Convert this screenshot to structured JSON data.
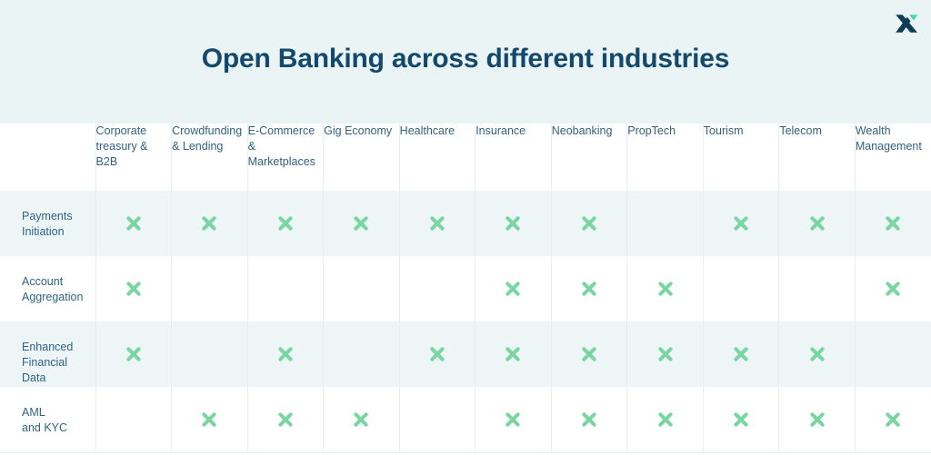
{
  "banner": {
    "title": "Open Banking across different industries",
    "logo_name": "x-logo",
    "background_color": "#eaf4f4",
    "title_color": "#13496b"
  },
  "table": {
    "corner_label": "",
    "columns": [
      "Corporate treasury & B2B",
      "Crowdfunding & Lending",
      "E-Commerce & Marketplaces",
      "Gig Economy",
      "Healthcare",
      "Insurance",
      "Neobanking",
      "PropTech",
      "Tourism",
      "Telecom",
      "Wealth Management"
    ],
    "rows": [
      {
        "label": "Payments\nInitiation",
        "marks": [
          true,
          true,
          true,
          true,
          true,
          true,
          true,
          false,
          true,
          true,
          true
        ]
      },
      {
        "label": "Account\nAggregation",
        "marks": [
          true,
          false,
          false,
          false,
          false,
          true,
          true,
          true,
          false,
          false,
          true
        ]
      },
      {
        "label": "Enhanced\nFinancial Data",
        "marks": [
          true,
          false,
          true,
          false,
          true,
          true,
          true,
          true,
          true,
          true,
          false
        ]
      },
      {
        "label": "AML\nand KYC",
        "marks": [
          false,
          true,
          true,
          true,
          false,
          true,
          true,
          true,
          true,
          true,
          true
        ]
      }
    ],
    "mark_icon": "x-mark-icon",
    "mark_color": "#79d6a0",
    "shaded_row_color": "#edf5f6",
    "grid_line_color": "#e7eff1"
  }
}
